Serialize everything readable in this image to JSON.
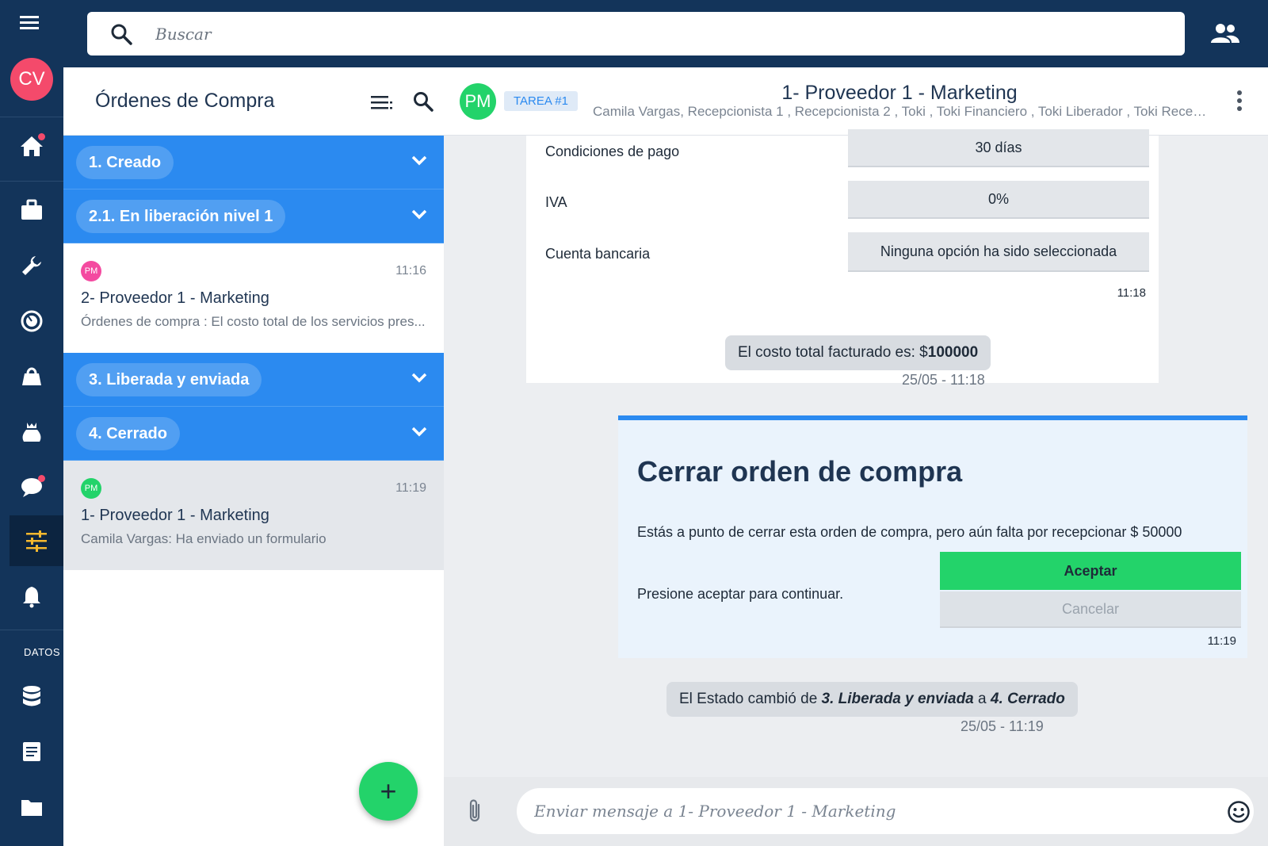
{
  "app": {
    "search_placeholder": "Buscar",
    "user_initials": "CV",
    "accent": "#2b8af0",
    "success": "#23d36a",
    "nav_dark": "#13345a",
    "rail_section_label": "DATOS"
  },
  "list": {
    "title": "Órdenes de Compra",
    "groups": [
      {
        "label": "1. Creado"
      },
      {
        "label": "2.1. En liberación nivel 1"
      },
      {
        "label": "3. Liberada y enviada"
      },
      {
        "label": "4. Cerrado"
      }
    ],
    "conversations": [
      {
        "initials": "PM",
        "time": "11:16",
        "name": "2- Proveedor 1 - Marketing",
        "preview": "Órdenes de compra : El costo total de los servicios pres...",
        "avatar_color": "#f44aa0"
      },
      {
        "initials": "PM",
        "time": "11:19",
        "name": "1- Proveedor 1 - Marketing",
        "preview": "Camila Vargas: Ha enviado un formulario",
        "avatar_color": "#23d36a"
      }
    ],
    "fab_label": "+"
  },
  "chat": {
    "avatar_initials": "PM",
    "badge": "TAREA #1",
    "title": "1- Proveedor 1 - Marketing",
    "participants": "Camila Vargas, Recepcionista 1 , Recepcionista 2 , Toki , Toki Financiero , Toki Liberador , Toki Recepcionista",
    "form": {
      "fields": [
        {
          "label": "Condiciones de pago",
          "value": "30 días"
        },
        {
          "label": "IVA",
          "value": "0%"
        },
        {
          "label": "Cuenta bancaria",
          "value": "Ninguna opción ha sido seleccionada"
        }
      ],
      "time": "11:18"
    },
    "cost_notice": {
      "prefix": "El costo total facturado es: $",
      "amount": "100000",
      "timestamp": "25/05 - 11:18"
    },
    "close_card": {
      "title": "Cerrar orden de compra",
      "text": "Estás a punto de cerrar esta orden de compra, pero aún falta por recepcionar $ 50000",
      "prompt": "Presione aceptar para continuar.",
      "accept_label": "Aceptar",
      "cancel_label": "Cancelar",
      "time": "11:19"
    },
    "state_notice": {
      "prefix": "El Estado cambió de ",
      "from": "3. Liberada y enviada",
      "middle": " a ",
      "to": "4. Cerrado",
      "timestamp": "25/05 - 11:19"
    },
    "composer_placeholder": "Enviar mensaje a 1- Proveedor 1 - Marketing"
  }
}
